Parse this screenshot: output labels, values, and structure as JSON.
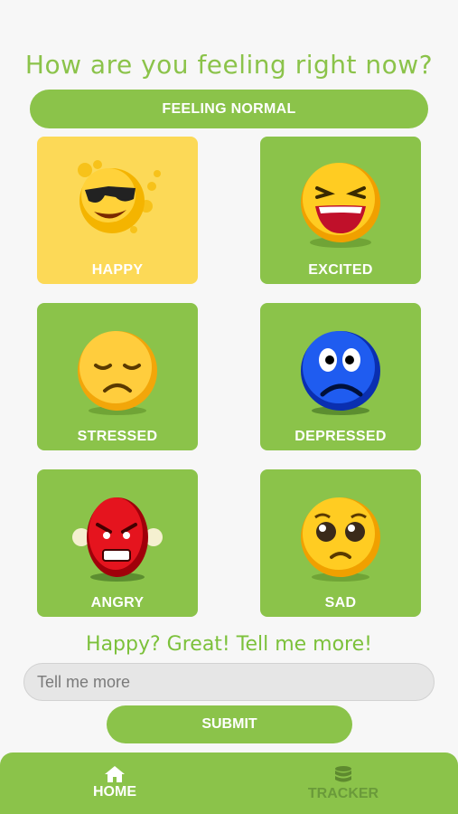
{
  "header": {
    "title": "How are you feeling right now?"
  },
  "status": {
    "text": "FEELING NORMAL"
  },
  "moods": [
    {
      "label": "HAPPY",
      "icon": "happy-sunglasses-emoji-icon",
      "selected": true
    },
    {
      "label": "EXCITED",
      "icon": "laughing-emoji-icon",
      "selected": false
    },
    {
      "label": "STRESSED",
      "icon": "sad-tired-emoji-icon",
      "selected": false
    },
    {
      "label": "DEPRESSED",
      "icon": "blue-worried-emoji-icon",
      "selected": false
    },
    {
      "label": "ANGRY",
      "icon": "red-angry-emoji-icon",
      "selected": false
    },
    {
      "label": "SAD",
      "icon": "pleading-emoji-icon",
      "selected": false
    }
  ],
  "prompt": {
    "text": "Happy? Great! Tell me more!"
  },
  "input": {
    "placeholder": "Tell me more",
    "value": ""
  },
  "submit": {
    "label": "SUBMIT"
  },
  "nav": {
    "home": {
      "label": "HOME",
      "icon": "home-icon"
    },
    "tracker": {
      "label": "TRACKER",
      "icon": "database-icon"
    }
  },
  "colors": {
    "accent": "#8bc34a",
    "selected": "#fcd957",
    "background": "#f7f7f7"
  }
}
